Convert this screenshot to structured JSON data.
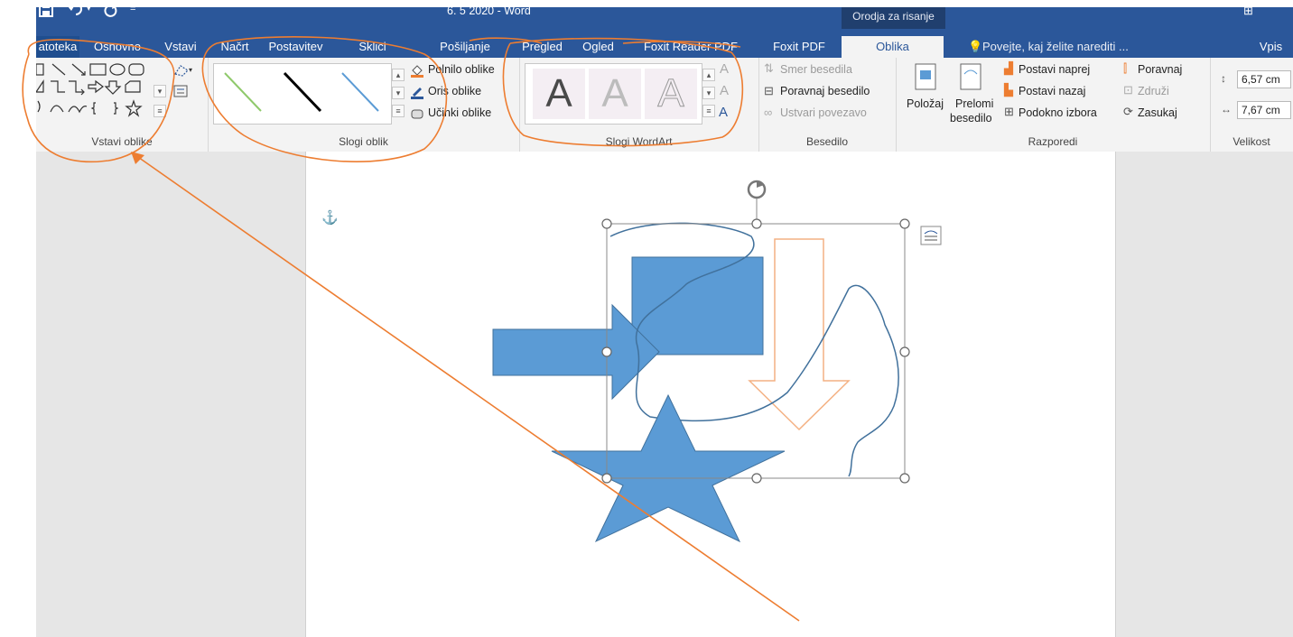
{
  "title_bar": {
    "document_title": "6. 5 2020 - Word",
    "context_header": "Orodja za risanje",
    "save_icon": "save-icon",
    "undo_icon": "undo-icon",
    "redo_icon": "redo-icon",
    "customize_icon": "customize-toolbar-icon"
  },
  "tabs": [
    {
      "label": "atoteka"
    },
    {
      "label": "Osnovno"
    },
    {
      "label": "Vstavi"
    },
    {
      "label": "Načrt"
    },
    {
      "label": "Postavitev"
    },
    {
      "label": "Sklici"
    },
    {
      "label": "Pošiljanje"
    },
    {
      "label": "Pregled"
    },
    {
      "label": "Ogled"
    },
    {
      "label": "Foxit Reader PDF"
    },
    {
      "label": "Foxit PDF"
    },
    {
      "label": "Oblika"
    }
  ],
  "tell_me": "Povejte, kaj želite narediti ...",
  "signin": "Vpis",
  "ribbon": {
    "insert_shapes": {
      "label": "Vstavi oblike"
    },
    "shape_styles": {
      "label": "Slogi oblik",
      "fill": "Polnilo oblike",
      "outline": "Oris oblike",
      "effects": "Učinki oblike",
      "line_colors": [
        "#8fc96b",
        "#000000",
        "#5b9bd5"
      ]
    },
    "wordart": {
      "label": "Slogi WordArt",
      "letters": [
        "A",
        "A",
        "A"
      ]
    },
    "text": {
      "label": "Besedilo",
      "direction": "Smer besedila",
      "align": "Poravnaj besedilo",
      "link": "Ustvari povezavo"
    },
    "arrange": {
      "label": "Razporedi",
      "position": "Položaj",
      "wrap_line1": "Prelomi",
      "wrap_line2": "besedilo",
      "bring_forward": "Postavi naprej",
      "send_backward": "Postavi nazaj",
      "selection_pane": "Podokno izbora",
      "align": "Poravnaj",
      "group": "Združi",
      "rotate": "Zasukaj"
    },
    "size": {
      "label": "Velikost",
      "height": "6,57 cm",
      "width": "7,67 cm"
    }
  },
  "colors": {
    "word_blue": "#2b579a",
    "shape_fill": "#5b9bd5",
    "shape_outline": "#41719c",
    "annotation": "#ed7d31"
  }
}
